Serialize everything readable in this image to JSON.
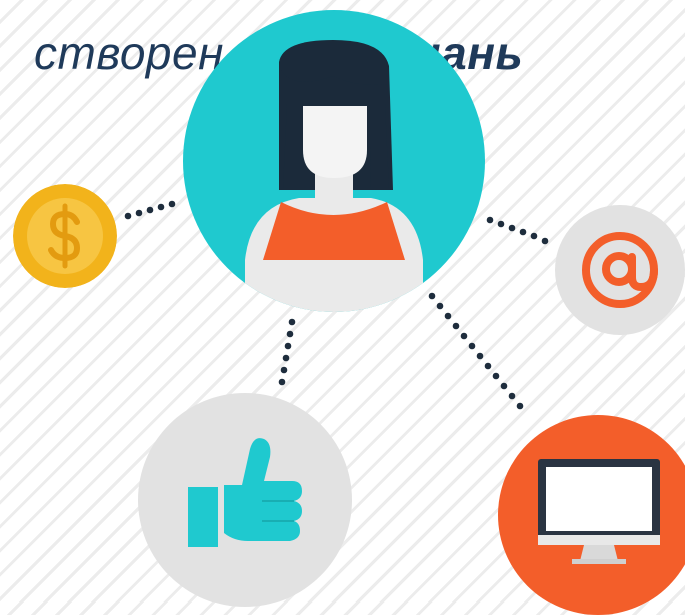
{
  "title": {
    "part1": "створен",
    "part2": "знань"
  },
  "icons": {
    "center": "woman-avatar-icon",
    "money": "dollar-coin-icon",
    "email": "at-sign-icon",
    "like": "thumbs-up-icon",
    "computer": "monitor-icon"
  },
  "colors": {
    "title": "#1f3a5a",
    "teal": "#1fc9cf",
    "coin": "#f2b31b",
    "orange": "#f35e2a",
    "grey_circle": "#e2e2e2"
  }
}
